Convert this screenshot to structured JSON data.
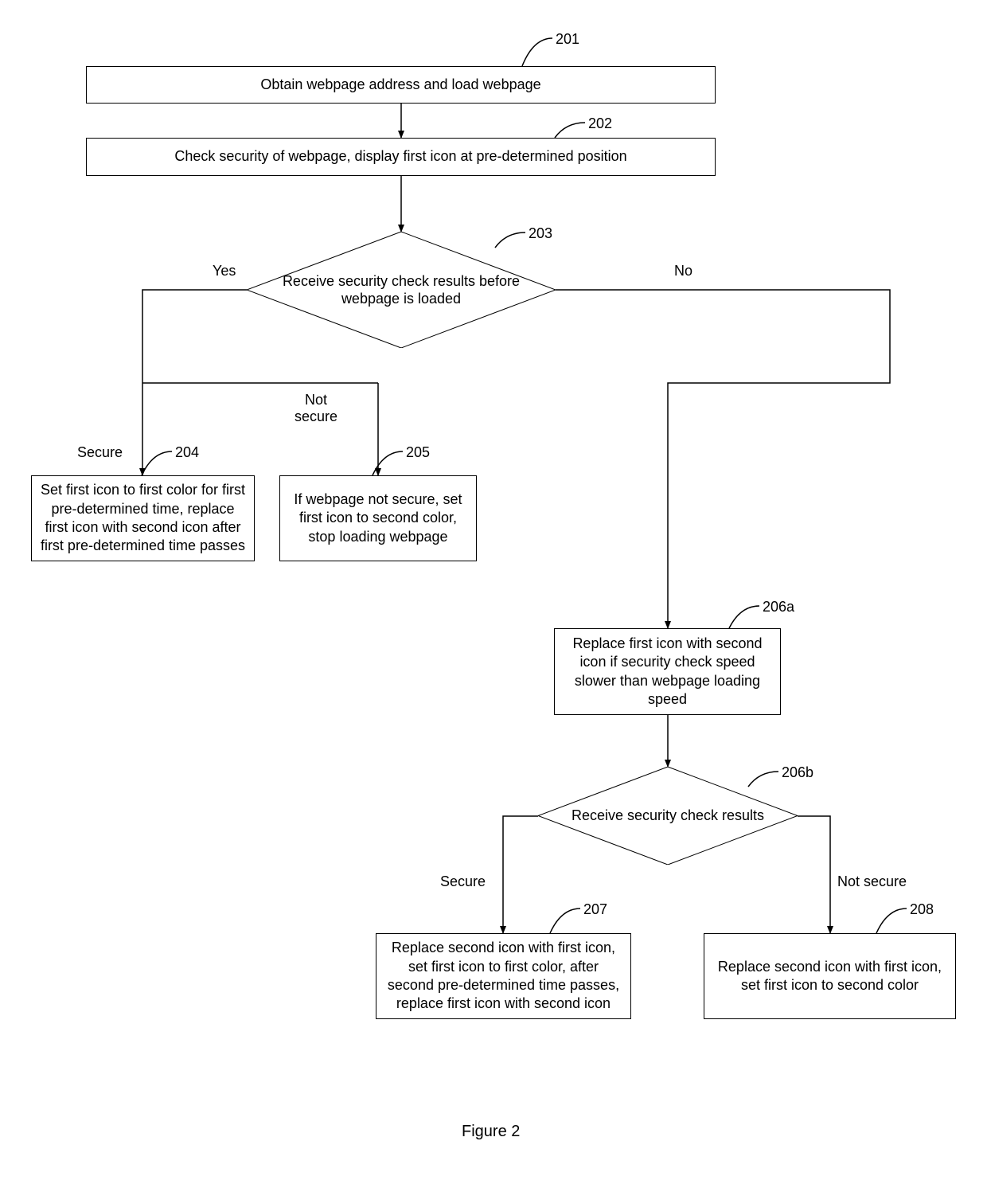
{
  "fig_caption": "Figure 2",
  "nodes": {
    "n201": {
      "ref": "201",
      "text": "Obtain webpage address and load webpage"
    },
    "n202": {
      "ref": "202",
      "text": "Check security of webpage, display first icon at pre-determined position"
    },
    "n203": {
      "ref": "203",
      "text": "Receive security check results before webpage is loaded"
    },
    "n204": {
      "ref": "204",
      "text": "Set first icon to first color for first pre-determined time, replace first icon with second icon after first pre-determined time passes"
    },
    "n205": {
      "ref": "205",
      "text": "If webpage not secure, set first icon to second color, stop loading webpage"
    },
    "n206a": {
      "ref": "206a",
      "text": "Replace first icon with second icon if security check speed slower than webpage loading speed"
    },
    "n206b": {
      "ref": "206b",
      "text": "Receive security check results"
    },
    "n207": {
      "ref": "207",
      "text": "Replace second icon with first icon, set first icon to first color, after second pre-determined time passes, replace first icon with second icon"
    },
    "n208": {
      "ref": "208",
      "text": "Replace second icon with first icon, set first icon to second color"
    }
  },
  "edge_labels": {
    "yes203": "Yes",
    "no203": "No",
    "secure204": "Secure",
    "notsecure205": "Not\nsecure",
    "secure207": "Secure",
    "notsecure208": "Not secure"
  }
}
